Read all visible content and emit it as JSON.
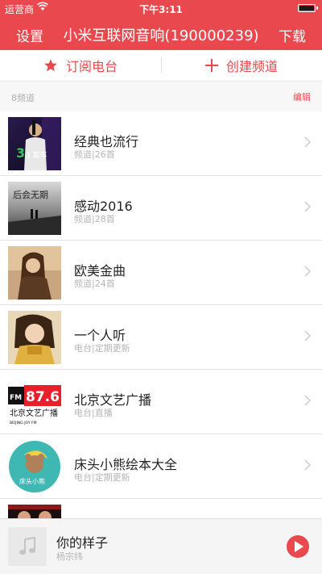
{
  "status_bar": {
    "carrier": "运营商",
    "time": "下午3:11"
  },
  "nav": {
    "left": "设置",
    "title": "小米互联网音响(190000239)",
    "right": "下载"
  },
  "actions": {
    "subscribe": "订阅电台",
    "create": "创建频道"
  },
  "section": {
    "count": "8频道",
    "edit": "编辑"
  },
  "channels": [
    {
      "title": "经典也流行",
      "subtitle": "频道|26首",
      "thumb_text": "3 套车"
    },
    {
      "title": "感动2016",
      "subtitle": "频道|28首",
      "thumb_text": "后会无期"
    },
    {
      "title": "欧美金曲",
      "subtitle": "频道|24首"
    },
    {
      "title": "一个人听",
      "subtitle": "电台|定期更新"
    },
    {
      "title": "北京文艺广播",
      "subtitle": "电台|直播",
      "thumb_fm": "FM",
      "thumb_freq": "87.6",
      "thumb_cn": "北京文艺广播",
      "thumb_en": "BEIJING JOY FM"
    },
    {
      "title": "床头小熊绘本大全",
      "subtitle": "电台|定期更新",
      "thumb_text": "床头小熊"
    }
  ],
  "player": {
    "song": "你的样子",
    "artist": "杨宗纬"
  },
  "colors": {
    "accent": "#e8484e",
    "divider": "#e6e6e6",
    "subtext": "#b5b5b5"
  }
}
